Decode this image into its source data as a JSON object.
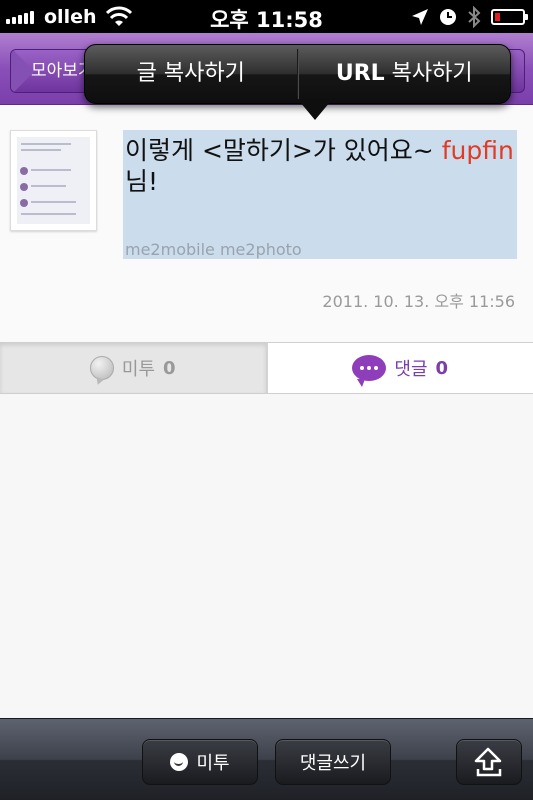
{
  "status_bar": {
    "carrier": "olleh",
    "time": "오후 11:58"
  },
  "nav": {
    "back_label": "모아보기"
  },
  "copy_menu": {
    "copy_text": "글 복사하기",
    "copy_url_bold": "URL",
    "copy_url_rest": " 복사하기"
  },
  "post": {
    "text_before": "이렇게 <말하기>가 있어요~ ",
    "mention": "fupfin",
    "text_after": " 님!",
    "source": "me2mobile me2photo",
    "date": "2011. 10. 13. 오후 11:56"
  },
  "tabs": {
    "me2_label": "미투",
    "me2_count": "0",
    "comment_label": "댓글",
    "comment_count": "0"
  },
  "toolbar": {
    "me2_button": "미투",
    "comment_button": "댓글쓰기"
  },
  "colors": {
    "nav_purple": "#8a4fb8",
    "mention_red": "#e23b25",
    "selection_blue": "#cbdcec",
    "comment_purple": "#7a3fab"
  }
}
